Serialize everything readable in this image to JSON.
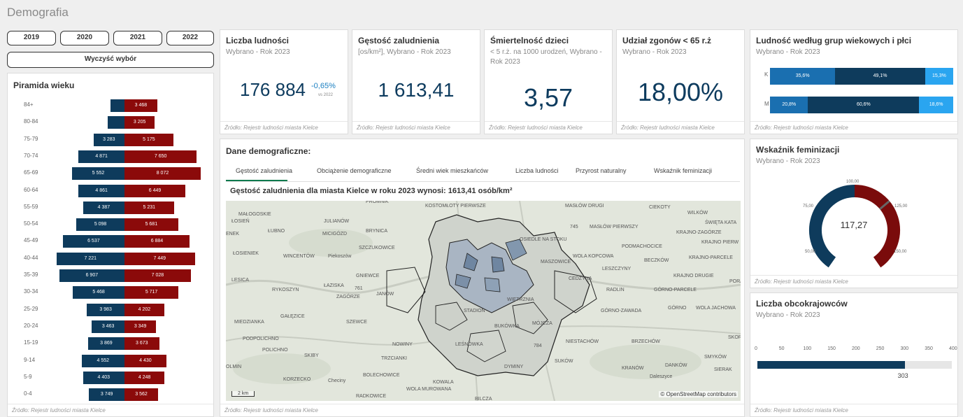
{
  "page": {
    "title": "Demografia"
  },
  "years": {
    "y2019": "2019",
    "y2020": "2020",
    "y2021": "2021",
    "y2022": "2022"
  },
  "clear_label": "Wyczyść wybór",
  "pyramid": {
    "title": "Piramida wieku",
    "source": "Źródło: Rejestr ludności miasta Kielce",
    "rows": [
      {
        "age": "84+",
        "left": "",
        "right": "3 468"
      },
      {
        "age": "80-84",
        "left": "",
        "right": "3 205"
      },
      {
        "age": "75-79",
        "left": "3 283",
        "right": "5 175"
      },
      {
        "age": "70-74",
        "left": "4 871",
        "right": "7 650"
      },
      {
        "age": "65-69",
        "left": "5 552",
        "right": "8 072"
      },
      {
        "age": "60-64",
        "left": "4 861",
        "right": "6 449"
      },
      {
        "age": "55-59",
        "left": "4 387",
        "right": "5 231"
      },
      {
        "age": "50-54",
        "left": "5 098",
        "right": "5 681"
      },
      {
        "age": "45-49",
        "left": "6 537",
        "right": "6 884"
      },
      {
        "age": "40-44",
        "left": "7 221",
        "right": "7 449"
      },
      {
        "age": "35-39",
        "left": "6 907",
        "right": "7 028"
      },
      {
        "age": "30-34",
        "left": "5 468",
        "right": "5 717"
      },
      {
        "age": "25-29",
        "left": "3 983",
        "right": "4 202"
      },
      {
        "age": "20-24",
        "left": "3 463",
        "right": "3 349"
      },
      {
        "age": "15-19",
        "left": "3 869",
        "right": "3 673"
      },
      {
        "age": "9-14",
        "left": "4 552",
        "right": "4 430"
      },
      {
        "age": "5-9",
        "left": "4 403",
        "right": "4 248"
      },
      {
        "age": "0-4",
        "left": "3 749",
        "right": "3 562"
      }
    ],
    "left_values": [
      0,
      0,
      3283,
      4871,
      5552,
      4861,
      4387,
      5098,
      6537,
      7221,
      6907,
      5468,
      3983,
      3463,
      3869,
      4552,
      4403,
      3749
    ],
    "left_small": [
      1500,
      1800
    ],
    "right_values": [
      3468,
      3205,
      5175,
      7650,
      8072,
      6449,
      5231,
      5681,
      6884,
      7449,
      7028,
      5717,
      4202,
      3349,
      3673,
      4430,
      4248,
      3562
    ]
  },
  "kpi1": {
    "title": "Liczba ludności",
    "sub": "Wybrano - Rok 2023",
    "value": "176 884",
    "delta": "-0,65%",
    "delta_ref": "vs 2022",
    "source": "Źródło: Rejestr ludności miasta Kielce"
  },
  "kpi2": {
    "title": "Gęstość zaludnienia",
    "sub": "[os/km²], Wybrano - Rok 2023",
    "value": "1 613,41",
    "source": "Źródło: Rejestr ludności miasta Kielce"
  },
  "kpi3": {
    "title": "Śmiertelność dzieci",
    "sub": "< 5 r.ż. na 1000 urodzeń, Wybrano - Rok 2023",
    "value": "3,57",
    "source": "Źródło: Rejestr ludności miasta Kielce"
  },
  "kpi4": {
    "title": "Udział zgonów < 65 r.ż",
    "sub": "Wybrano - Rok 2023",
    "value": "18,00%",
    "source": "Źródło: Rejestr ludności miasta Kielce"
  },
  "agegroups": {
    "title": "Ludność według grup wiekowych i płci",
    "sub": "Wybrano - Rok 2023",
    "source": "Źródło: Rejestr ludności miasta Kielce",
    "k": {
      "label": "K",
      "a": "35,6%",
      "b": "49,1%",
      "c": "15,3%",
      "fa": 0.356,
      "fb": 0.491,
      "fc": 0.153
    },
    "m": {
      "label": "M",
      "a": "20,8%",
      "b": "60,6%",
      "c": "18,6%",
      "fa": 0.208,
      "fb": 0.606,
      "fc": 0.186
    },
    "colors": {
      "a": "#1a6fb0",
      "b": "#0e3b5c",
      "c": "#2aa5f0"
    }
  },
  "demo": {
    "title": "Dane demograficzne:",
    "tabs": [
      "Gęstość zaludnienia",
      "Obciążenie demograficzne",
      "Średni wiek mieszkańców",
      "Liczba ludności",
      "Przyrost naturalny",
      "Wskaźnik feminizacji"
    ],
    "heading": "Gęstość zaludnienia dla miasta Kielce w roku 2023 wynosi: 1613,41 osób/km²",
    "scale": "2 km",
    "attribution": "© OpenStreetMap contributors",
    "source": "Źródło: Rejestr ludności miasta Kielce",
    "places": [
      "PROMNIK",
      "KOSTOMŁOTY PIERWSZE",
      "MASŁÓW DRUGI",
      "CIEKOTY",
      "MAŁOGOSKIE",
      "WILKÓW",
      "ŁOSIEŃ",
      "JULIANÓW",
      "ŚWIĘTA KATA",
      "ENEK",
      "ŁUBNO",
      "MICIGÓZD",
      "BRYNICA",
      "745",
      "MASŁÓW PIERWSZY",
      "KRAJNO-ZAGÓRZE",
      "SZCZUKOWICE",
      "OSIEDLE NA STOKU",
      "KRAJNO PIERW",
      "ŁOSIENIEK",
      "WINCENTÓW",
      "Piekoszów",
      "PODMACHOCICE",
      "WOLA KOPCOWA",
      "BECZKÓW",
      "KRAJNO-PARCELE",
      "GNIEWCE",
      "MASZOWICE",
      "LESZCZYNY",
      "LESICA",
      "CEDZYNA",
      "KRAJNO DRUGIE",
      "PORA",
      "ŁAZISKA",
      "761",
      "RYKOSZYN",
      "RADLIN",
      "GÓRNO-PARCELE",
      "ZAGÓRZE",
      "JANÓW",
      "WIETRZNIA",
      "STADION",
      "GÓRNO-ZAWADA",
      "GÓRNO",
      "WOLA JACHOWA",
      "MIEDZIANKA",
      "GAŁĘZICE",
      "SZEWCE",
      "MÓJCZA",
      "BUKÓWKA",
      "PODPOLICHNO",
      "NIESTACHÓW",
      "BRZECHÓW",
      "SKORZESZ",
      "NOWINY",
      "LEŚNÓWKA",
      "784",
      "POLICHNO",
      "SKIBY",
      "TRZCIANKI",
      "SUKÓW",
      "SMYKÓW",
      "OLMIN",
      "DYMINY",
      "KRANÓW",
      "DANKÓW",
      "SIERAK",
      "KORZECKO",
      "Checiny",
      "BOLECHOWICE",
      "KOWALA",
      "Daleszyce",
      "WOLA MUROWANA",
      "RADKOWICE",
      "BILCZA"
    ]
  },
  "gauge": {
    "title": "Wskaźnik feminizacji",
    "sub": "Wybrano - Rok 2023",
    "value": "117,27",
    "numeric": 117.27,
    "min": 50,
    "max": 150,
    "labels": [
      "50,00",
      "75,00",
      "100,00",
      "125,00",
      "150,00"
    ],
    "source": "Źródło: Rejestr ludności miasta Kielce"
  },
  "foreign": {
    "title": "Liczba obcokrajowców",
    "sub": "Wybrano - Rok 2023",
    "value": "303",
    "numeric": 303,
    "axis": [
      "0",
      "50",
      "100",
      "150",
      "200",
      "250",
      "300",
      "350",
      "400"
    ],
    "max": 400,
    "source": "Źródło: Rejestr ludności miasta Kielce"
  }
}
